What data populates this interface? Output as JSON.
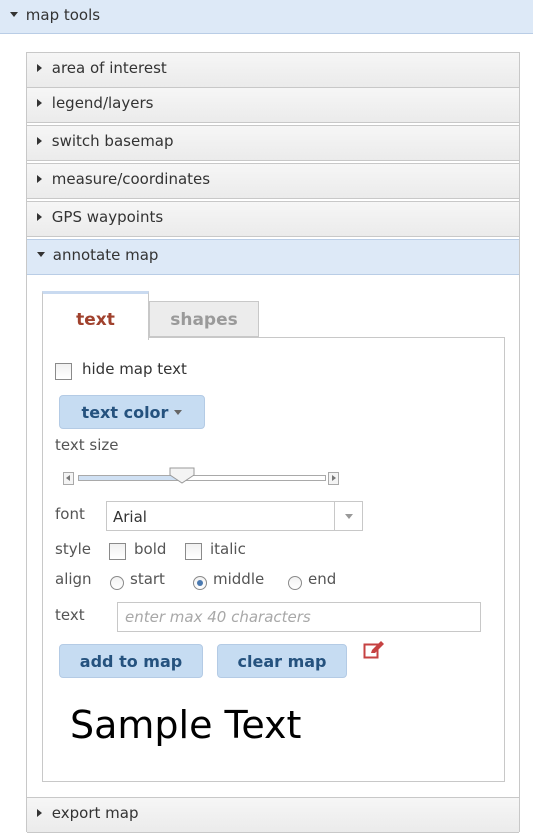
{
  "top_header": {
    "label": "map tools"
  },
  "accordion": {
    "items": [
      {
        "label": "area of interest"
      },
      {
        "label": "legend/layers"
      },
      {
        "label": "switch basemap"
      },
      {
        "label": "measure/coordinates"
      },
      {
        "label": "GPS waypoints"
      },
      {
        "label": "annotate map"
      },
      {
        "label": "export map"
      }
    ]
  },
  "annotate": {
    "tabs": {
      "text": "text",
      "shapes": "shapes"
    },
    "hide_map_text": "hide map text",
    "text_color_button": "text color",
    "text_size_label": "text size",
    "text_size_fraction": 0.42,
    "font_label": "font",
    "font_value": "Arial",
    "style_label": "style",
    "bold_label": "bold",
    "italic_label": "italic",
    "align_label": "align",
    "align_options": [
      "start",
      "middle",
      "end"
    ],
    "align_selected": "middle",
    "text_label": "text",
    "text_placeholder": "enter max 40 characters",
    "add_button": "add to map",
    "clear_button": "clear map",
    "sample_text": "Sample Text"
  },
  "colors": {
    "header_blue": "#dde9f7",
    "button_blue": "#c6dcf2",
    "button_text": "#25527e",
    "active_tab_text": "#a0412d",
    "edit_icon": "#c64242"
  },
  "icons": {
    "expanded": "triangle-down-icon",
    "collapsed": "triangle-right-icon",
    "edit": "pencil-edit-icon"
  }
}
